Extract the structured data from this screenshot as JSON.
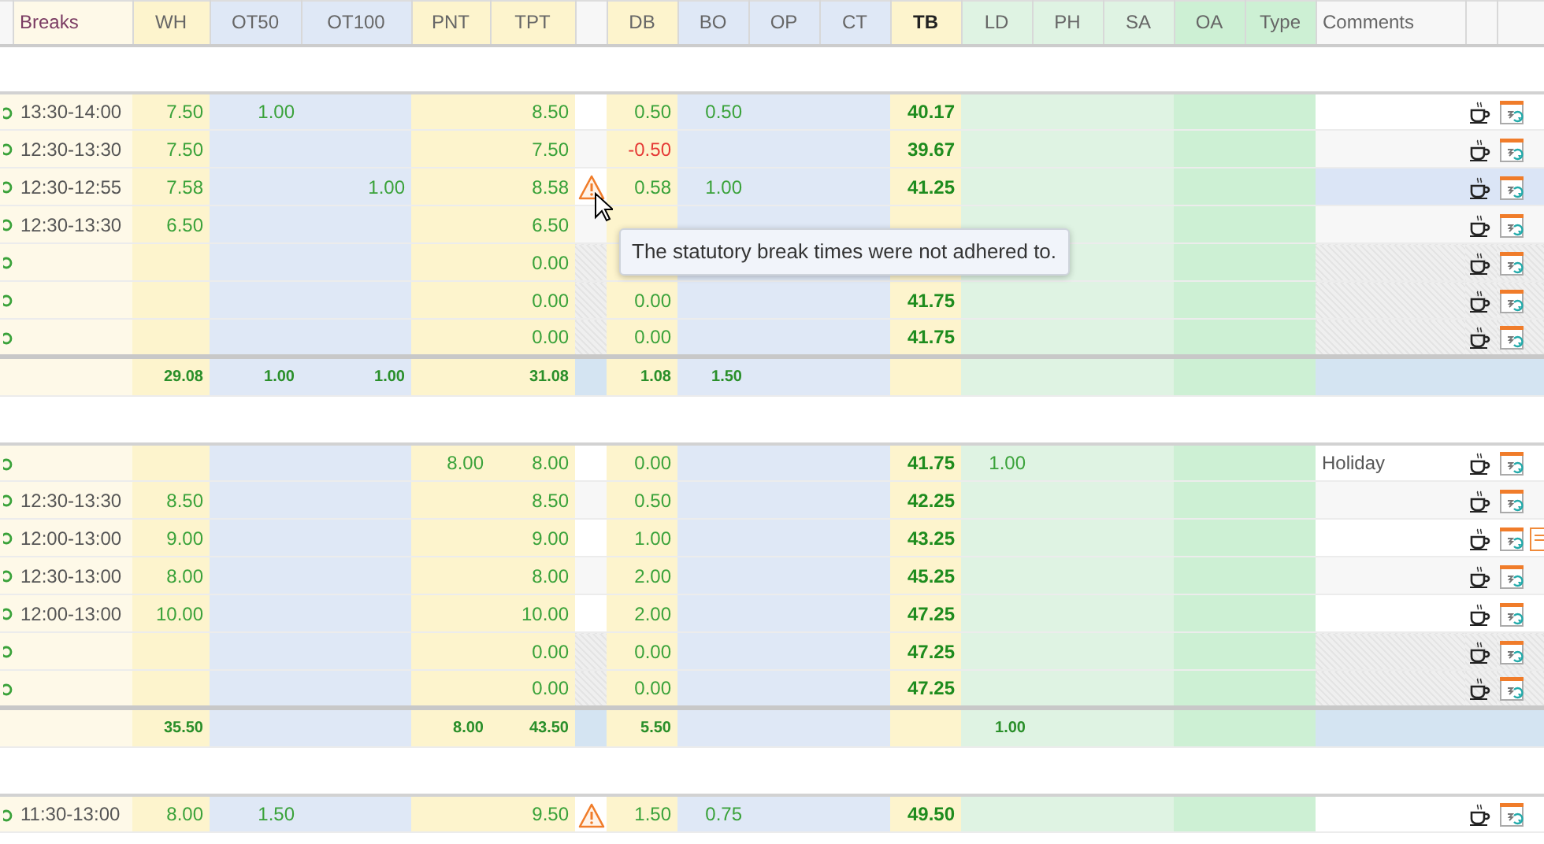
{
  "columns": [
    "Breaks",
    "WH",
    "OT50",
    "OT100",
    "PNT",
    "TPT",
    "DB",
    "BO",
    "OP",
    "CT",
    "TB",
    "LD",
    "PH",
    "SA",
    "OA",
    "Type",
    "Comments"
  ],
  "groups": [
    {
      "rows": [
        {
          "kind": "workday",
          "hovered": false,
          "warning": false,
          "note": false,
          "db_negative": false,
          "breaks": "13:30-14:00",
          "wh": "7.50",
          "ot50": "1.00",
          "tpt": "8.50",
          "db": "0.50",
          "bo": "0.50",
          "tb": "40.17"
        },
        {
          "kind": "workday",
          "hovered": false,
          "warning": false,
          "note": false,
          "db_negative": true,
          "breaks": "12:30-13:30",
          "wh": "7.50",
          "tpt": "7.50",
          "db": "-0.50",
          "tb": "39.67"
        },
        {
          "kind": "workday",
          "hovered": true,
          "warning": true,
          "note": false,
          "db_negative": false,
          "breaks": "12:30-12:55",
          "wh": "7.58",
          "ot100": "1.00",
          "tpt": "8.58",
          "db": "0.58",
          "bo": "1.00",
          "tb": "41.25"
        },
        {
          "kind": "workday",
          "hovered": false,
          "warning": false,
          "note": false,
          "breaks": "12:30-13:30",
          "wh": "6.50",
          "tpt": "6.50"
        },
        {
          "kind": "weekend",
          "hovered": false,
          "warning": false,
          "note": false,
          "tpt": "0.00"
        },
        {
          "kind": "weekend",
          "hovered": false,
          "warning": false,
          "note": false,
          "db_negative": false,
          "tpt": "0.00",
          "db": "0.00",
          "tb": "41.75"
        },
        {
          "kind": "weekend",
          "hovered": false,
          "warning": false,
          "note": false,
          "db_negative": false,
          "tpt": "0.00",
          "db": "0.00",
          "tb": "41.75"
        }
      ],
      "totals": {
        "wh": "29.08",
        "ot50": "1.00",
        "ot100": "1.00",
        "tpt": "31.08",
        "db": "1.08",
        "bo": "1.50"
      }
    },
    {
      "rows": [
        {
          "kind": "workday",
          "hovered": false,
          "warning": false,
          "note": false,
          "db_negative": false,
          "pnt": "8.00",
          "tpt": "8.00",
          "db": "0.00",
          "tb": "41.75",
          "ld": "1.00",
          "comments": "Holiday"
        },
        {
          "kind": "workday",
          "hovered": false,
          "warning": false,
          "note": false,
          "db_negative": false,
          "breaks": "12:30-13:30",
          "wh": "8.50",
          "tpt": "8.50",
          "db": "0.50",
          "tb": "42.25"
        },
        {
          "kind": "workday",
          "hovered": false,
          "warning": false,
          "note": true,
          "db_negative": false,
          "breaks": "12:00-13:00",
          "wh": "9.00",
          "tpt": "9.00",
          "db": "1.00",
          "tb": "43.25"
        },
        {
          "kind": "workday",
          "hovered": false,
          "warning": false,
          "note": false,
          "db_negative": false,
          "breaks": "12:30-13:00",
          "wh": "8.00",
          "tpt": "8.00",
          "db": "2.00",
          "tb": "45.25"
        },
        {
          "kind": "workday",
          "hovered": false,
          "warning": false,
          "note": false,
          "db_negative": false,
          "breaks": "12:00-13:00",
          "wh": "10.00",
          "tpt": "10.00",
          "db": "2.00",
          "tb": "47.25"
        },
        {
          "kind": "weekend",
          "hovered": false,
          "warning": false,
          "note": false,
          "db_negative": false,
          "tpt": "0.00",
          "db": "0.00",
          "tb": "47.25"
        },
        {
          "kind": "weekend",
          "hovered": false,
          "warning": false,
          "note": false,
          "db_negative": false,
          "tpt": "0.00",
          "db": "0.00",
          "tb": "47.25"
        }
      ],
      "totals": {
        "wh": "35.50",
        "pnt": "8.00",
        "tpt": "43.50",
        "db": "5.50",
        "ld": "1.00"
      }
    },
    {
      "rows": [
        {
          "kind": "workday",
          "hovered": false,
          "warning": true,
          "note": false,
          "db_negative": false,
          "breaks": "11:30-13:00",
          "wh": "8.00",
          "ot50": "1.50",
          "tpt": "9.50",
          "db": "1.50",
          "bo": "0.75",
          "tb": "49.50"
        }
      ]
    }
  ],
  "tooltip": {
    "text": "The statutory break times were not adhered to."
  }
}
